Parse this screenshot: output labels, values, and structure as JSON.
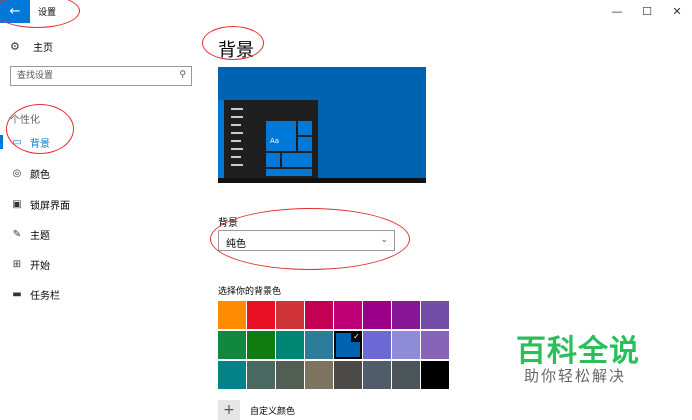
{
  "window": {
    "title": "设置",
    "controls": {
      "minimize": "—",
      "maximize": "☐",
      "close": "✕"
    }
  },
  "sidebar": {
    "home_label": "主页",
    "search_placeholder": "查找设置",
    "section_label": "个性化",
    "items": [
      {
        "label": "背景",
        "icon": "picture-icon",
        "active": true
      },
      {
        "label": "颜色",
        "icon": "palette-icon"
      },
      {
        "label": "锁屏界面",
        "icon": "lock-screen-icon"
      },
      {
        "label": "主题",
        "icon": "theme-brush-icon"
      },
      {
        "label": "开始",
        "icon": "start-menu-icon"
      },
      {
        "label": "任务栏",
        "icon": "taskbar-icon"
      }
    ]
  },
  "main": {
    "page_title": "背景",
    "preview": {
      "tile_label": "Aa"
    },
    "background_label": "背景",
    "background_value": "纯色",
    "color_label": "选择你的背景色",
    "custom_color_label": "自定义颜色",
    "swatch_colors": [
      "#ff8c00",
      "#e81123",
      "#d13438",
      "#c30052",
      "#bf0077",
      "#9a0089",
      "#881798",
      "#744da9",
      "#10893e",
      "#107c10",
      "#018574",
      "#2d7d9a",
      "#0063b1",
      "#6b69d6",
      "#8e8cd8",
      "#8764b8",
      "#038387",
      "#486860",
      "#525e54",
      "#7e735f",
      "#4c4a48",
      "#515c6b",
      "#4a5459",
      "#000000"
    ],
    "selected_swatch": 12
  },
  "accent": "#0078d7",
  "watermark": {
    "main": "百科全说",
    "sub": "助你轻松解决"
  }
}
